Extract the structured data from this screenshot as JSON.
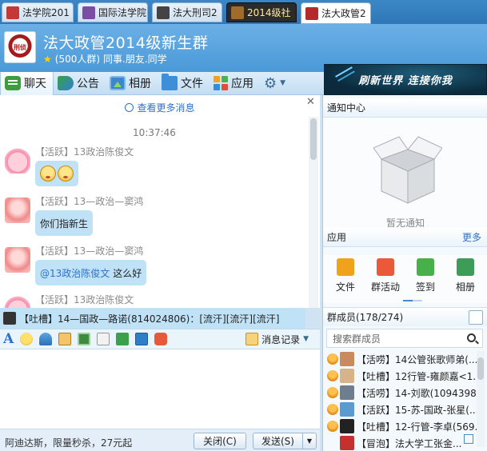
{
  "tabs": [
    {
      "label": "法学院201",
      "selected": false,
      "active": false
    },
    {
      "label": "国际法学院",
      "selected": false,
      "active": false
    },
    {
      "label": "法大刑司2",
      "selected": false,
      "active": false
    },
    {
      "label": "2014级社",
      "selected": true,
      "active": false
    },
    {
      "label": "法大政管2",
      "selected": false,
      "active": true
    }
  ],
  "group": {
    "name": "法大政管2014级新生群",
    "size": "(500人群)",
    "tags": "同事.朋友.同学",
    "logo_text": "刑侦"
  },
  "toolbar": {
    "chat": "聊天",
    "notice": "公告",
    "album": "相册",
    "files": "文件",
    "apps": "应用"
  },
  "banner": {
    "text": "刷新世界 连接你我"
  },
  "chat": {
    "view_more": "查看更多消息",
    "timestamp": "10:37:46",
    "messages": [
      {
        "sender": "【活跃】13政治陈俊文",
        "text": "",
        "emoji_count": 2,
        "avatar": "pig"
      },
      {
        "sender": "【活跃】13—政治—窦鸿",
        "text": "你们指新生",
        "avatar": "ghost"
      },
      {
        "sender": "【活跃】13—政治—窦鸿",
        "mention": "@13政治陈俊文",
        "text": "这么好",
        "avatar": "ghost"
      },
      {
        "sender": "【活跃】13政治陈俊文",
        "text": "",
        "avatar": "pig"
      }
    ]
  },
  "announcement": "【吐槽】14—国政—路诺(814024806)：[流汗][流汗][流汗]",
  "input_toolbar": {
    "history": "消息记录"
  },
  "bottom": {
    "ad": "阿迪达斯，限量秒杀，27元起",
    "close": "关闭(C)",
    "send": "发送(S)"
  },
  "notice_center": {
    "title": "通知中心",
    "empty": "暂无通知"
  },
  "apps": {
    "title": "应用",
    "more": "更多",
    "items": [
      "文件",
      "群活动",
      "签到",
      "相册"
    ]
  },
  "members": {
    "title": "群成员(178/274)",
    "search_placeholder": "搜索群成员",
    "list": [
      "【活唠】14公管张歌师弟(...",
      "【吐槽】12行管-雍颜嘉<1...",
      "【活唠】14-刘歌(1094398...",
      "【活跃】15-苏-国政-张星(...",
      "【吐槽】12-行管-李卓(569...",
      "【冒泡】法大学工张金..."
    ]
  },
  "colors": {
    "title_bar": "#4a99d8",
    "bubble": "#bfe2f7",
    "link": "#2d72c6"
  }
}
